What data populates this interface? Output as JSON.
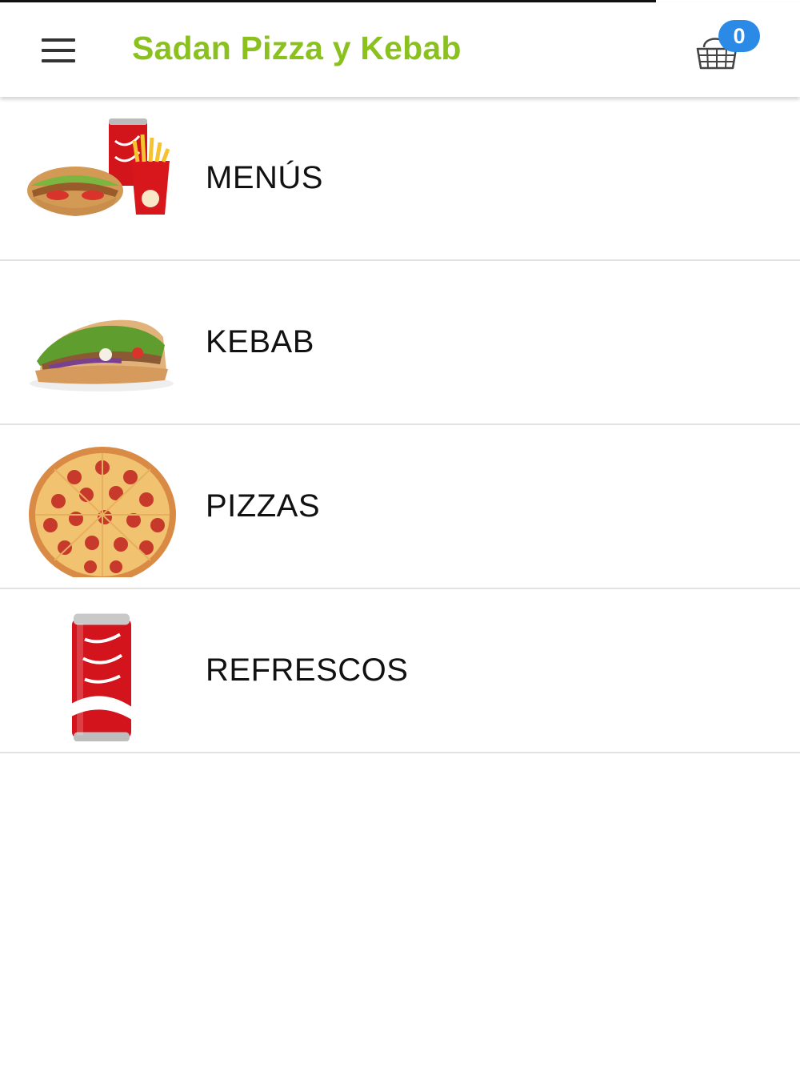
{
  "header": {
    "title": "Sadan Pizza y Kebab",
    "menu_icon": "hamburger-menu-icon",
    "cart_icon": "shopping-basket-icon",
    "cart_count": "0",
    "title_color": "#8bc11f",
    "badge_color": "#2a8ae6"
  },
  "categories": [
    {
      "label": "MENÚS",
      "image": "kebab-combo-image"
    },
    {
      "label": "KEBAB",
      "image": "kebab-sandwich-image"
    },
    {
      "label": "PIZZAS",
      "image": "pepperoni-pizza-image"
    },
    {
      "label": "REFRESCOS",
      "image": "cola-can-image"
    }
  ]
}
